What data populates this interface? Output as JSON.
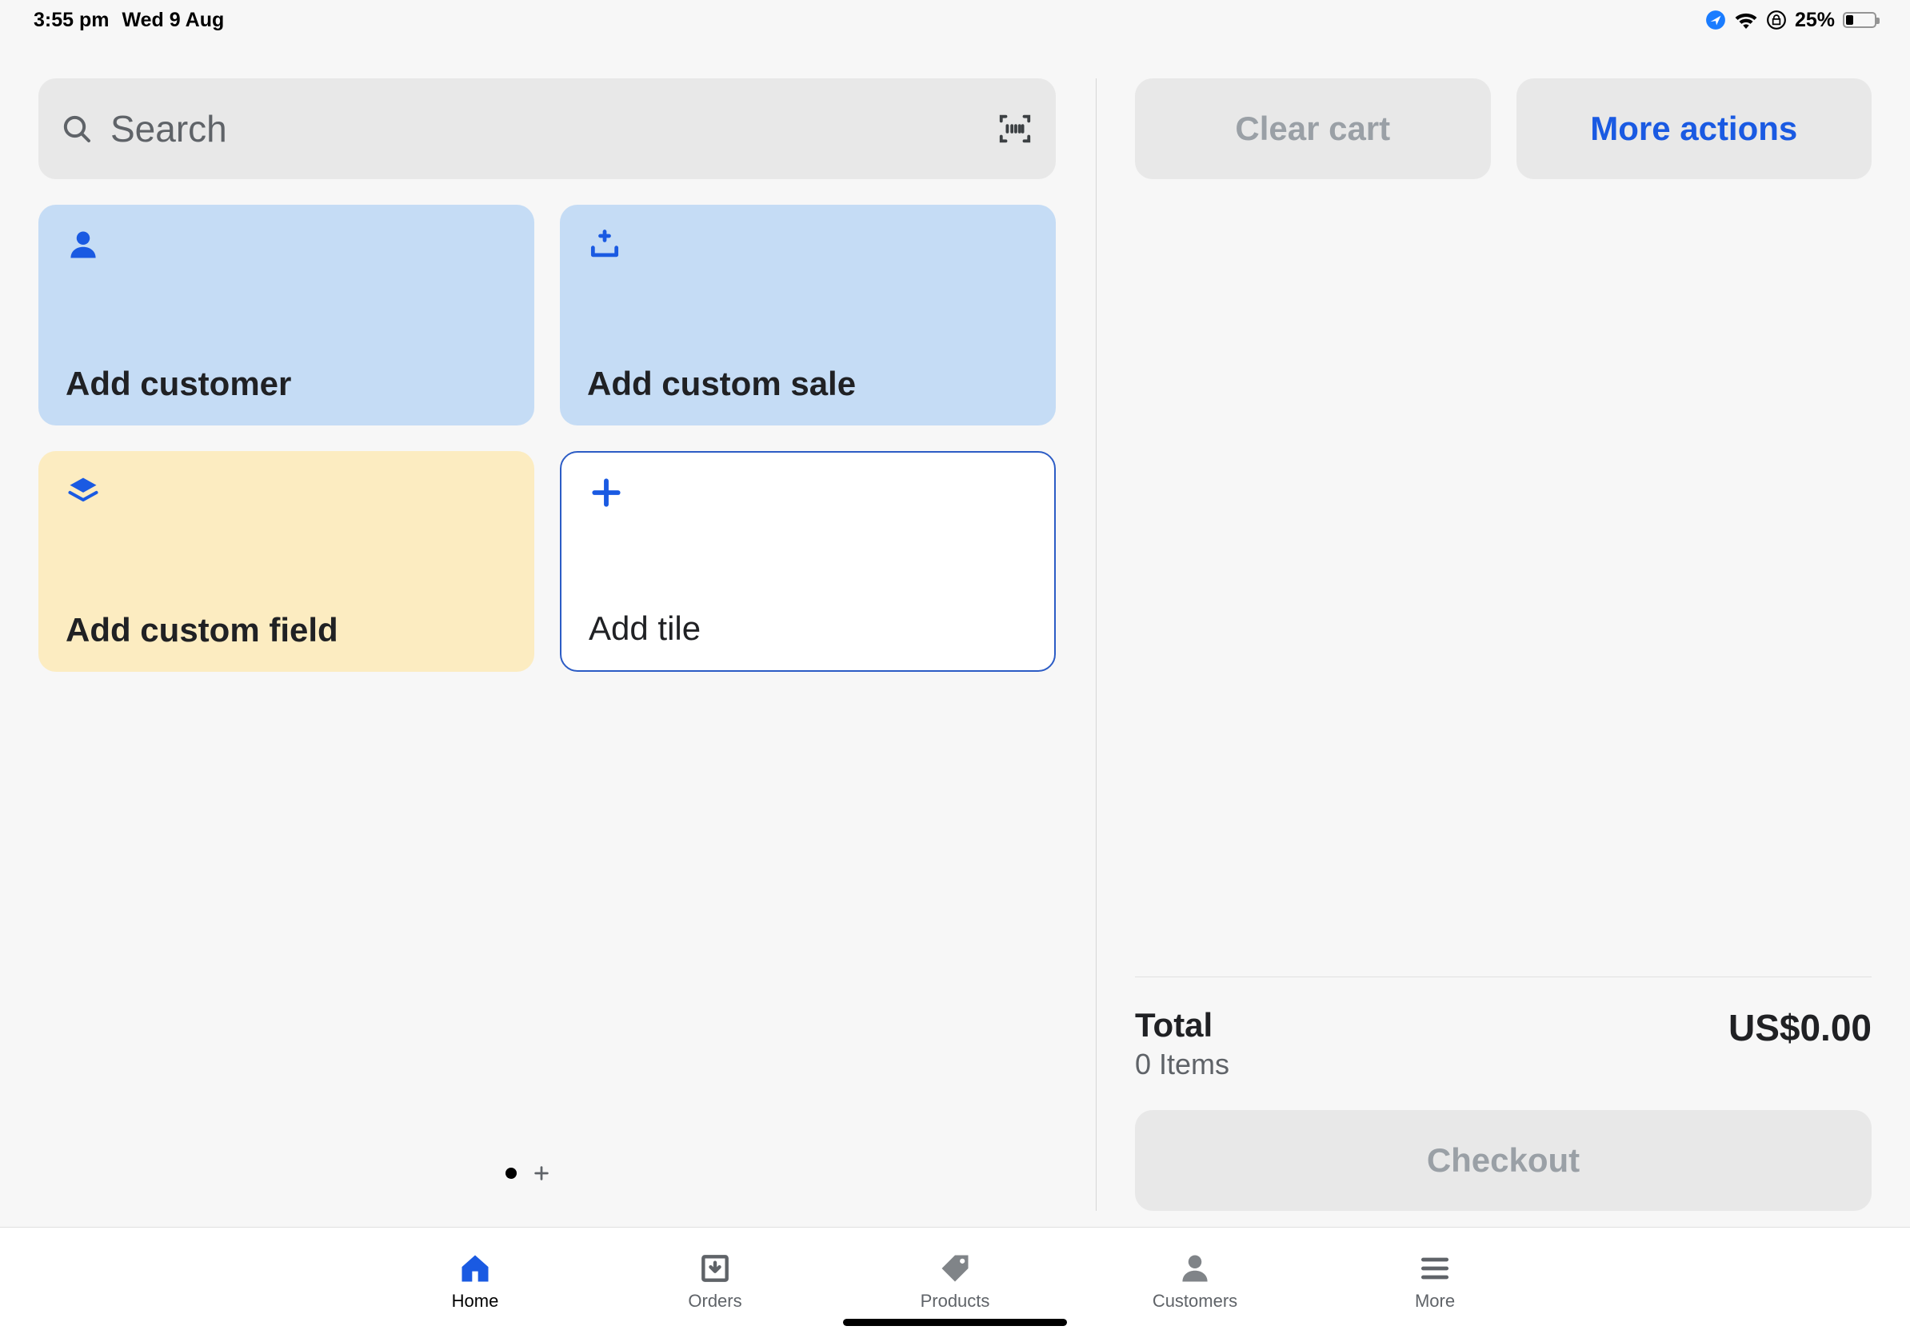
{
  "status_bar": {
    "time": "3:55 pm",
    "date": "Wed 9 Aug",
    "battery_pct": "25%",
    "battery_fill_pct": 25
  },
  "search": {
    "placeholder": "Search"
  },
  "tiles": {
    "add_customer": "Add customer",
    "add_custom_sale": "Add custom sale",
    "add_custom_field": "Add custom field",
    "add_tile": "Add tile"
  },
  "cart": {
    "clear_label": "Clear cart",
    "more_label": "More actions",
    "total_label": "Total",
    "items_label": "0 Items",
    "total_amount": "US$0.00",
    "checkout_label": "Checkout"
  },
  "tabs": {
    "home": "Home",
    "orders": "Orders",
    "products": "Products",
    "customers": "Customers",
    "more": "More"
  }
}
